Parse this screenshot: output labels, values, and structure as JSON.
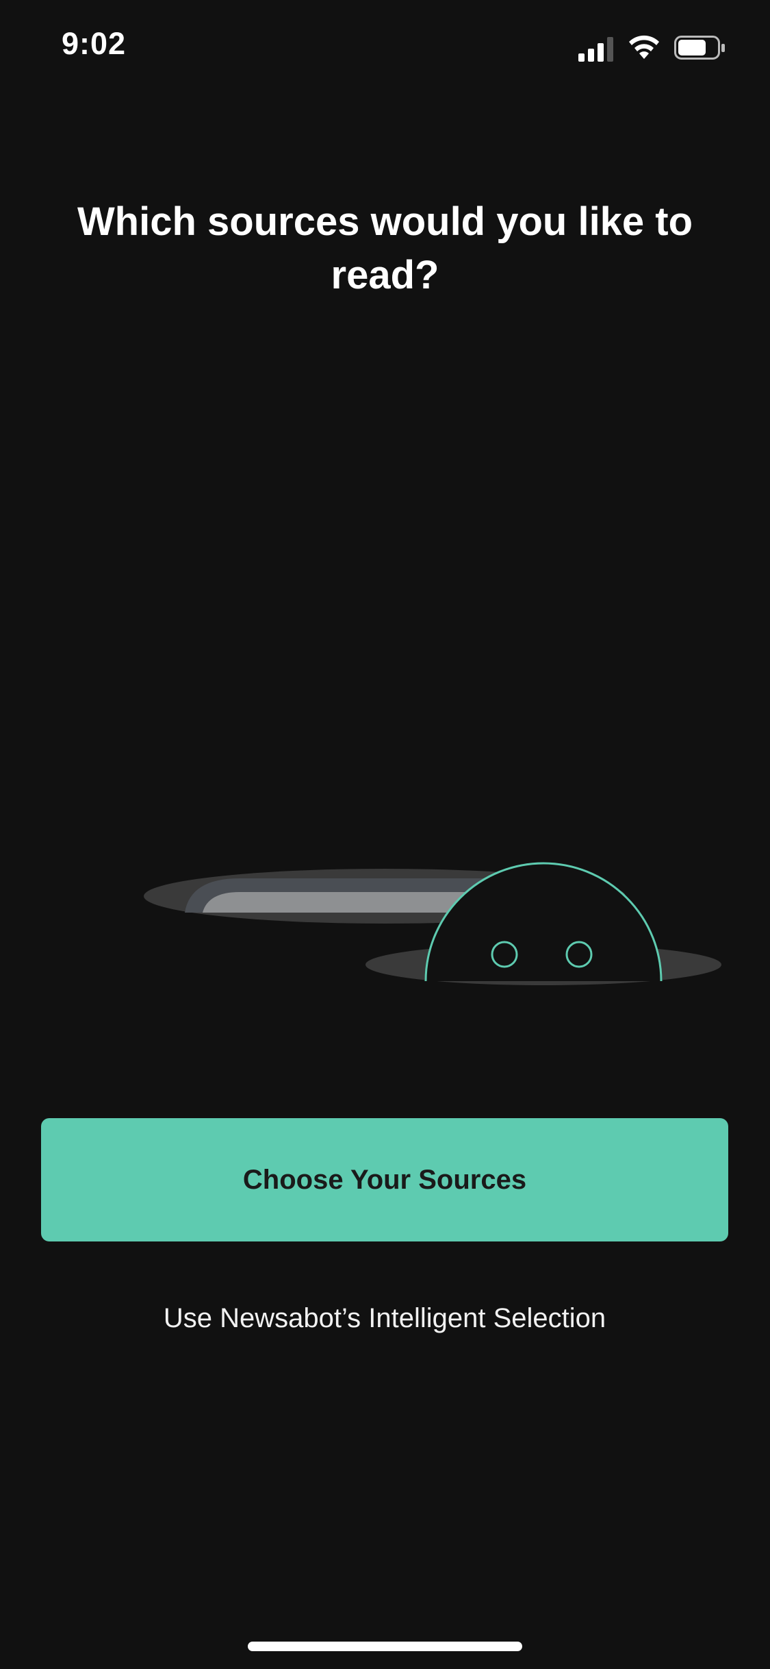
{
  "status_bar": {
    "time": "9:02",
    "icons": [
      "cellular-signal-icon",
      "wifi-icon",
      "battery-icon"
    ]
  },
  "onboarding": {
    "title": "Which sources would you like to read?",
    "primary_button_label": "Choose Your Sources",
    "secondary_link_label": "Use Newsabot’s Intelligent Selection"
  },
  "colors": {
    "background": "#111111",
    "accent": "#5ecbb0",
    "button_text": "#1a1a1a",
    "text": "#ffffff"
  }
}
